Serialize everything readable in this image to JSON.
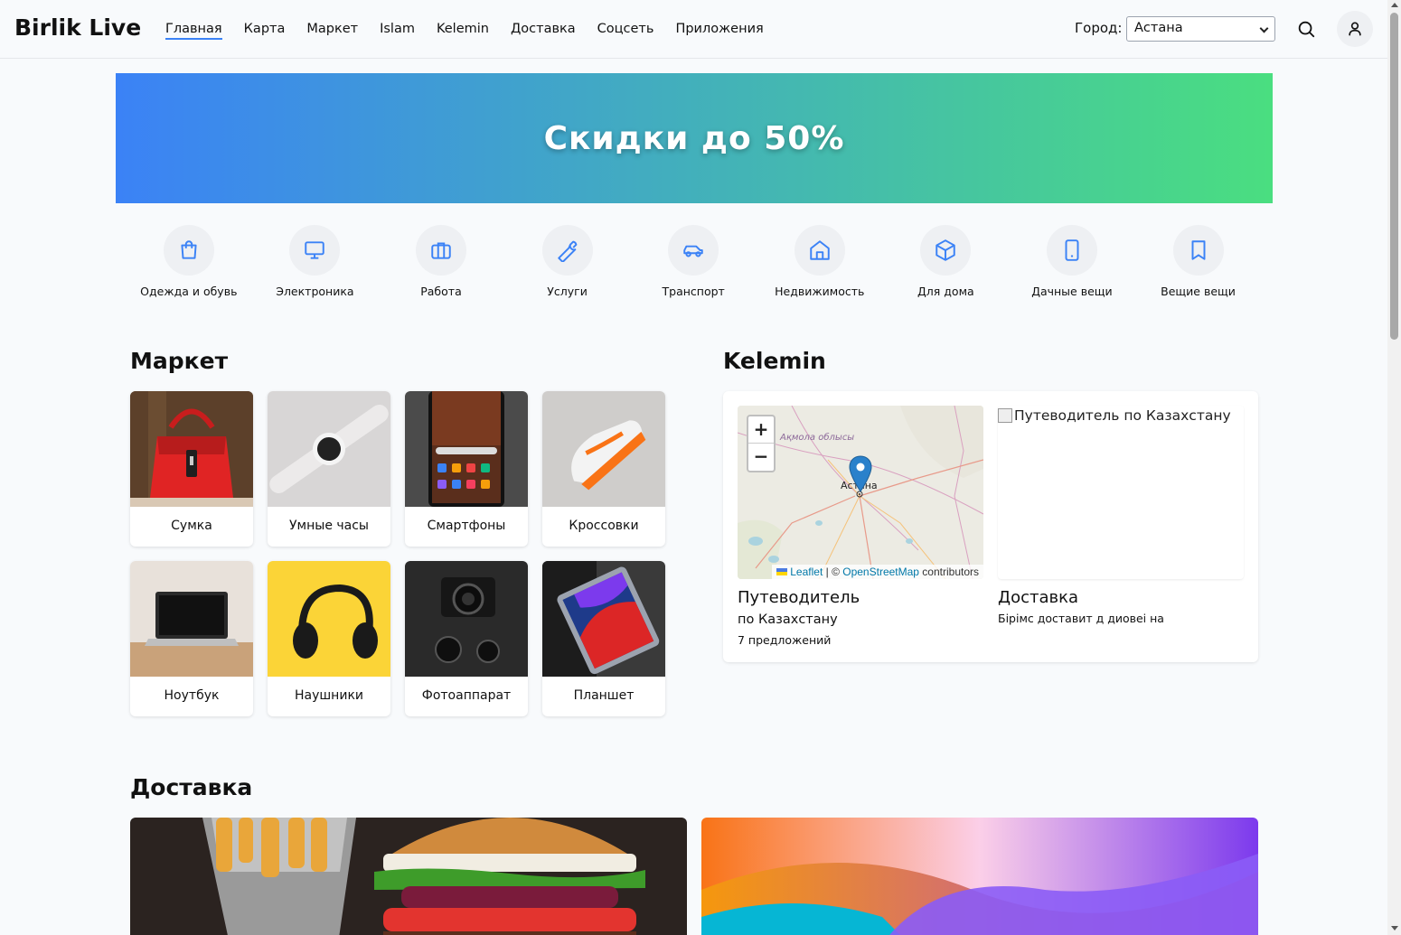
{
  "header": {
    "logo": "Birlik Live",
    "nav": [
      "Главная",
      "Карта",
      "Маркет",
      "Islam",
      "Kelemin",
      "Доставка",
      "Соцсеть",
      "Приложения"
    ],
    "active_nav": "Главная",
    "city_label": "Город:",
    "city_value": "Астана"
  },
  "banner": {
    "title": "Скидки до 50%"
  },
  "categories": [
    {
      "label": "Одежда и обувь",
      "icon": "shopping-bag-icon"
    },
    {
      "label": "Электроника",
      "icon": "monitor-icon"
    },
    {
      "label": "Работа",
      "icon": "briefcase-icon"
    },
    {
      "label": "Услуги",
      "icon": "wrench-icon"
    },
    {
      "label": "Транспорт",
      "icon": "car-icon"
    },
    {
      "label": "Недвижимость",
      "icon": "home-icon"
    },
    {
      "label": "Для дома",
      "icon": "box-icon"
    },
    {
      "label": "Дачные вещи",
      "icon": "tablet-icon"
    },
    {
      "label": "Вещие вещи",
      "icon": "bookmark-icon"
    }
  ],
  "market": {
    "title": "Маркет",
    "items": [
      "Сумка",
      "Умные часы",
      "Смартфоны",
      "Кроссовки",
      "Ноутбук",
      "Наушники",
      "Фотоаппарат",
      "Планшет"
    ]
  },
  "kelemin": {
    "title": "Kelemin",
    "map": {
      "region_label": "Ақмола облысы",
      "city_label": "Астана",
      "zoom_in": "+",
      "zoom_out": "−",
      "attribution_leaflet": "Leaflet",
      "attribution_sep": " | © ",
      "attribution_osm": "OpenStreetMap",
      "attribution_tail": " contributors"
    },
    "guide": {
      "image_alt": "Путеводитель по Казахстану",
      "title": "Путеводитель",
      "subtitle": "по Казахстану",
      "count": "7 предложений"
    },
    "delivery": {
      "title": "Доставка",
      "subtitle": "Бірімс доставит д диовеі на"
    }
  },
  "delivery_section": {
    "title": "Доставка"
  },
  "colors": {
    "accent": "#3b82f6",
    "banner_start": "#3b82f6",
    "banner_end": "#4ade80"
  }
}
